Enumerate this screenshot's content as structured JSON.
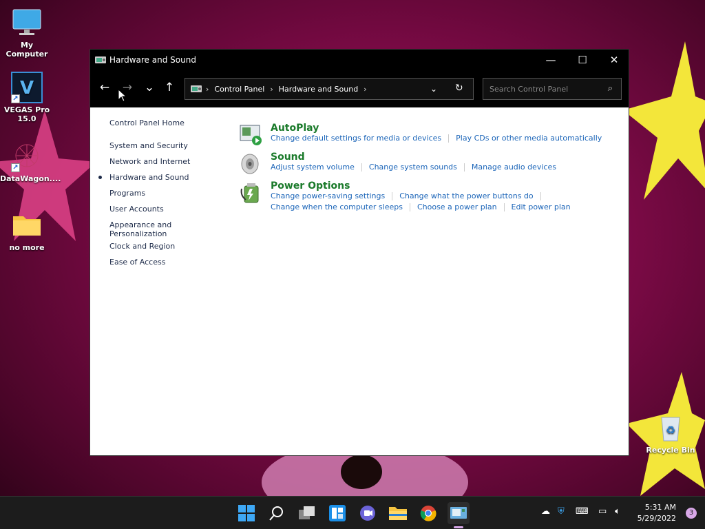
{
  "desktop": {
    "icons": [
      {
        "label": "My Computer"
      },
      {
        "label": "VEGAS Pro 15.0"
      },
      {
        "label": "DataWagon...."
      },
      {
        "label": "no more"
      },
      {
        "label": "Recycle Bin"
      }
    ]
  },
  "window": {
    "title": "Hardware and Sound",
    "controls": {
      "minimize": "—",
      "maximize": "☐",
      "close": "✕"
    }
  },
  "nav": {
    "back": "←",
    "forward": "→",
    "recent": "⌄",
    "up": "↑",
    "breadcrumb": [
      "Control Panel",
      "Hardware and Sound"
    ],
    "search_placeholder": "Search Control Panel"
  },
  "sidebar": {
    "items": [
      {
        "label": "Control Panel Home"
      },
      {
        "label": "System and Security"
      },
      {
        "label": "Network and Internet"
      },
      {
        "label": "Hardware and Sound",
        "current": true
      },
      {
        "label": "Programs"
      },
      {
        "label": "User Accounts"
      },
      {
        "label": "Appearance and Personalization"
      },
      {
        "label": "Clock and Region"
      },
      {
        "label": "Ease of Access"
      }
    ]
  },
  "categories": [
    {
      "title": "AutoPlay",
      "links": [
        "Change default settings for media or devices",
        "Play CDs or other media automatically"
      ]
    },
    {
      "title": "Sound",
      "links": [
        "Adjust system volume",
        "Change system sounds",
        "Manage audio devices"
      ]
    },
    {
      "title": "Power Options",
      "links": [
        "Change power-saving settings",
        "Change what the power buttons do",
        "Change when the computer sleeps",
        "Choose a power plan",
        "Edit power plan"
      ]
    }
  ],
  "taskbar": {
    "time": "5:31 AM",
    "date": "5/29/2022",
    "notification_count": "3"
  },
  "colors": {
    "link": "#1a64b8",
    "category_title": "#1a7a2a",
    "titlebar": "#000000"
  }
}
